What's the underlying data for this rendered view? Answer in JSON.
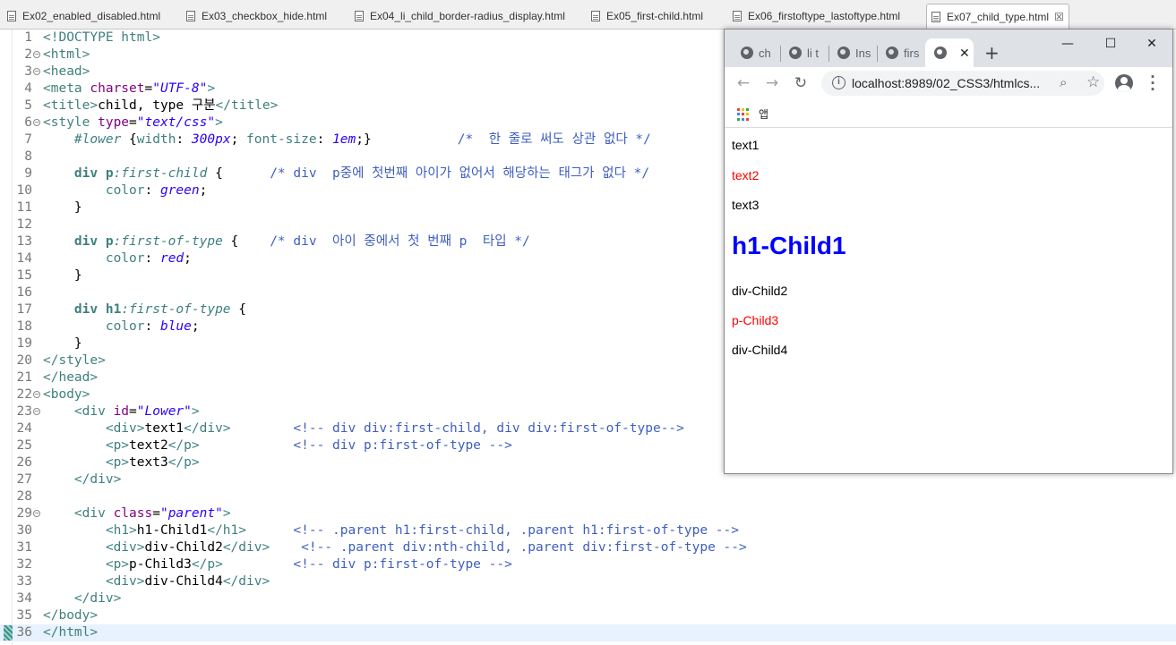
{
  "editor_tabs": [
    {
      "label": "Ex02_enabled_disabled.html",
      "active": false
    },
    {
      "label": "Ex03_checkbox_hide.html",
      "active": false
    },
    {
      "label": "Ex04_li_child_border-radius_display.html",
      "active": false
    },
    {
      "label": "Ex05_first-child.html",
      "active": false
    },
    {
      "label": "Ex06_firstoftype_lastoftype.html",
      "active": false
    },
    {
      "label": "Ex07_child_type.html",
      "active": true
    }
  ],
  "code_lines": [
    {
      "n": "1",
      "fold": false,
      "tokens": [
        [
          "c-tag",
          "<!DOCTYPE html>"
        ]
      ]
    },
    {
      "n": "2",
      "fold": true,
      "tokens": [
        [
          "c-tag",
          "<html>"
        ]
      ]
    },
    {
      "n": "3",
      "fold": true,
      "tokens": [
        [
          "c-tag",
          "<head>"
        ]
      ]
    },
    {
      "n": "4",
      "fold": false,
      "tokens": [
        [
          "c-tag",
          "<meta "
        ],
        [
          "c-attr",
          "charset"
        ],
        [
          "c-text",
          "="
        ],
        [
          "c-val",
          "\"UTF-8\""
        ],
        [
          "c-tag",
          ">"
        ]
      ]
    },
    {
      "n": "5",
      "fold": false,
      "tokens": [
        [
          "c-tag",
          "<title>"
        ],
        [
          "c-text",
          "child, type 구분"
        ],
        [
          "c-tag",
          "</title>"
        ]
      ]
    },
    {
      "n": "6",
      "fold": true,
      "tokens": [
        [
          "c-tag",
          "<style "
        ],
        [
          "c-attr",
          "type"
        ],
        [
          "c-text",
          "="
        ],
        [
          "c-val",
          "\"text/css\""
        ],
        [
          "c-tag",
          ">"
        ]
      ]
    },
    {
      "n": "7",
      "fold": false,
      "tokens": [
        [
          "c-text",
          "    "
        ],
        [
          "c-id",
          "#lower"
        ],
        [
          "c-text",
          " {"
        ],
        [
          "c-prop",
          "width"
        ],
        [
          "c-text",
          ": "
        ],
        [
          "c-cval",
          "300px"
        ],
        [
          "c-text",
          "; "
        ],
        [
          "c-prop",
          "font-size"
        ],
        [
          "c-text",
          ": "
        ],
        [
          "c-cval",
          "1em"
        ],
        [
          "c-text",
          ";}           "
        ],
        [
          "c-comment",
          "/*  한 줄로 써도 상관 없다 */"
        ]
      ]
    },
    {
      "n": "8",
      "fold": false,
      "tokens": []
    },
    {
      "n": "9",
      "fold": false,
      "tokens": [
        [
          "c-text",
          "    "
        ],
        [
          "c-sel",
          "div p"
        ],
        [
          "c-pseudo",
          ":first-child"
        ],
        [
          "c-text",
          " {      "
        ],
        [
          "c-comment",
          "/* div  p중에 첫번째 아이가 없어서 해당하는 태그가 없다 */"
        ]
      ]
    },
    {
      "n": "10",
      "fold": false,
      "tokens": [
        [
          "c-text",
          "        "
        ],
        [
          "c-prop",
          "color"
        ],
        [
          "c-text",
          ": "
        ],
        [
          "c-cval",
          "green"
        ],
        [
          "c-text",
          ";"
        ]
      ]
    },
    {
      "n": "11",
      "fold": false,
      "tokens": [
        [
          "c-text",
          "    }"
        ]
      ]
    },
    {
      "n": "12",
      "fold": false,
      "tokens": []
    },
    {
      "n": "13",
      "fold": false,
      "tokens": [
        [
          "c-text",
          "    "
        ],
        [
          "c-sel",
          "div p"
        ],
        [
          "c-pseudo",
          ":first-of-type"
        ],
        [
          "c-text",
          " {    "
        ],
        [
          "c-comment",
          "/* div  아이 중에서 첫 번째 p  타입 */"
        ]
      ]
    },
    {
      "n": "14",
      "fold": false,
      "tokens": [
        [
          "c-text",
          "        "
        ],
        [
          "c-prop",
          "color"
        ],
        [
          "c-text",
          ": "
        ],
        [
          "c-cval",
          "red"
        ],
        [
          "c-text",
          ";"
        ]
      ]
    },
    {
      "n": "15",
      "fold": false,
      "tokens": [
        [
          "c-text",
          "    }"
        ]
      ]
    },
    {
      "n": "16",
      "fold": false,
      "tokens": []
    },
    {
      "n": "17",
      "fold": false,
      "tokens": [
        [
          "c-text",
          "    "
        ],
        [
          "c-sel",
          "div h1"
        ],
        [
          "c-pseudo",
          ":first-of-type"
        ],
        [
          "c-text",
          " {"
        ]
      ]
    },
    {
      "n": "18",
      "fold": false,
      "tokens": [
        [
          "c-text",
          "        "
        ],
        [
          "c-prop",
          "color"
        ],
        [
          "c-text",
          ": "
        ],
        [
          "c-cval",
          "blue"
        ],
        [
          "c-text",
          ";"
        ]
      ]
    },
    {
      "n": "19",
      "fold": false,
      "tokens": [
        [
          "c-text",
          "    }"
        ]
      ]
    },
    {
      "n": "20",
      "fold": false,
      "tokens": [
        [
          "c-tag",
          "</style>"
        ]
      ]
    },
    {
      "n": "21",
      "fold": false,
      "tokens": [
        [
          "c-tag",
          "</head>"
        ]
      ]
    },
    {
      "n": "22",
      "fold": true,
      "tokens": [
        [
          "c-tag",
          "<body>"
        ]
      ]
    },
    {
      "n": "23",
      "fold": true,
      "tokens": [
        [
          "c-text",
          "    "
        ],
        [
          "c-tag",
          "<div "
        ],
        [
          "c-attr",
          "id"
        ],
        [
          "c-text",
          "="
        ],
        [
          "c-val",
          "\"Lower\""
        ],
        [
          "c-tag",
          ">"
        ]
      ]
    },
    {
      "n": "24",
      "fold": false,
      "tokens": [
        [
          "c-text",
          "        "
        ],
        [
          "c-tag",
          "<div>"
        ],
        [
          "c-text",
          "text1"
        ],
        [
          "c-tag",
          "</div>"
        ],
        [
          "c-text",
          "        "
        ],
        [
          "c-comment",
          "<!-- div div:first-child, div div:first-of-type-->"
        ]
      ]
    },
    {
      "n": "25",
      "fold": false,
      "tokens": [
        [
          "c-text",
          "        "
        ],
        [
          "c-tag",
          "<p>"
        ],
        [
          "c-text",
          "text2"
        ],
        [
          "c-tag",
          "</p>"
        ],
        [
          "c-text",
          "            "
        ],
        [
          "c-comment",
          "<!-- div p:first-of-type -->"
        ]
      ]
    },
    {
      "n": "26",
      "fold": false,
      "tokens": [
        [
          "c-text",
          "        "
        ],
        [
          "c-tag",
          "<p>"
        ],
        [
          "c-text",
          "text3"
        ],
        [
          "c-tag",
          "</p>"
        ]
      ]
    },
    {
      "n": "27",
      "fold": false,
      "tokens": [
        [
          "c-text",
          "    "
        ],
        [
          "c-tag",
          "</div>"
        ]
      ]
    },
    {
      "n": "28",
      "fold": false,
      "tokens": []
    },
    {
      "n": "29",
      "fold": true,
      "tokens": [
        [
          "c-text",
          "    "
        ],
        [
          "c-tag",
          "<div "
        ],
        [
          "c-attr",
          "class"
        ],
        [
          "c-text",
          "="
        ],
        [
          "c-val",
          "\"parent\""
        ],
        [
          "c-tag",
          ">"
        ]
      ]
    },
    {
      "n": "30",
      "fold": false,
      "tokens": [
        [
          "c-text",
          "        "
        ],
        [
          "c-tag",
          "<h1>"
        ],
        [
          "c-text",
          "h1-Child1"
        ],
        [
          "c-tag",
          "</h1>"
        ],
        [
          "c-text",
          "      "
        ],
        [
          "c-comment",
          "<!-- .parent h1:first-child, .parent h1:first-of-type -->"
        ]
      ]
    },
    {
      "n": "31",
      "fold": false,
      "tokens": [
        [
          "c-text",
          "        "
        ],
        [
          "c-tag",
          "<div>"
        ],
        [
          "c-text",
          "div-Child2"
        ],
        [
          "c-tag",
          "</div>"
        ],
        [
          "c-text",
          "    "
        ],
        [
          "c-comment",
          "<!-- .parent div:nth-child, .parent div:first-of-type -->"
        ]
      ]
    },
    {
      "n": "32",
      "fold": false,
      "tokens": [
        [
          "c-text",
          "        "
        ],
        [
          "c-tag",
          "<p>"
        ],
        [
          "c-text",
          "p-Child3"
        ],
        [
          "c-tag",
          "</p>"
        ],
        [
          "c-text",
          "         "
        ],
        [
          "c-comment",
          "<!-- div p:first-of-type -->"
        ]
      ]
    },
    {
      "n": "33",
      "fold": false,
      "tokens": [
        [
          "c-text",
          "        "
        ],
        [
          "c-tag",
          "<div>"
        ],
        [
          "c-text",
          "div-Child4"
        ],
        [
          "c-tag",
          "</div>"
        ]
      ]
    },
    {
      "n": "34",
      "fold": false,
      "tokens": [
        [
          "c-text",
          "    "
        ],
        [
          "c-tag",
          "</div>"
        ]
      ]
    },
    {
      "n": "35",
      "fold": false,
      "tokens": [
        [
          "c-tag",
          "</body>"
        ]
      ]
    },
    {
      "n": "36",
      "fold": false,
      "current": true,
      "tokens": [
        [
          "c-tag",
          "</html>"
        ]
      ]
    }
  ],
  "browser": {
    "tabs": [
      {
        "label": "ch",
        "active": false
      },
      {
        "label": "li t",
        "active": false
      },
      {
        "label": "Ins",
        "active": false
      },
      {
        "label": "firs",
        "active": false
      },
      {
        "label": "",
        "active": true
      }
    ],
    "new_tab_symbol": "+",
    "window_controls": {
      "minimize": "—",
      "maximize": "☐",
      "close": "✕"
    },
    "nav": {
      "back": "←",
      "forward": "→",
      "reload": "↻"
    },
    "url": "localhost:8989/02_CSS3/htmlcs...",
    "bookmarks": {
      "apps_label": "앱"
    },
    "icons": {
      "info": "info-icon",
      "zoom": "zoom-icon",
      "star": "star-icon",
      "profile": "profile-icon",
      "menu": "menu-icon"
    },
    "page": [
      {
        "text": "text1",
        "color": "#000000",
        "kind": "p"
      },
      {
        "text": "text2",
        "color": "#ff0000",
        "kind": "p"
      },
      {
        "text": "text3",
        "color": "#000000",
        "kind": "p"
      },
      {
        "text": "h1-Child1",
        "color": "#0000ff",
        "kind": "h1"
      },
      {
        "text": "div-Child2",
        "color": "#000000",
        "kind": "p"
      },
      {
        "text": "p-Child3",
        "color": "#ff0000",
        "kind": "p"
      },
      {
        "text": "div-Child4",
        "color": "#000000",
        "kind": "p"
      }
    ]
  }
}
